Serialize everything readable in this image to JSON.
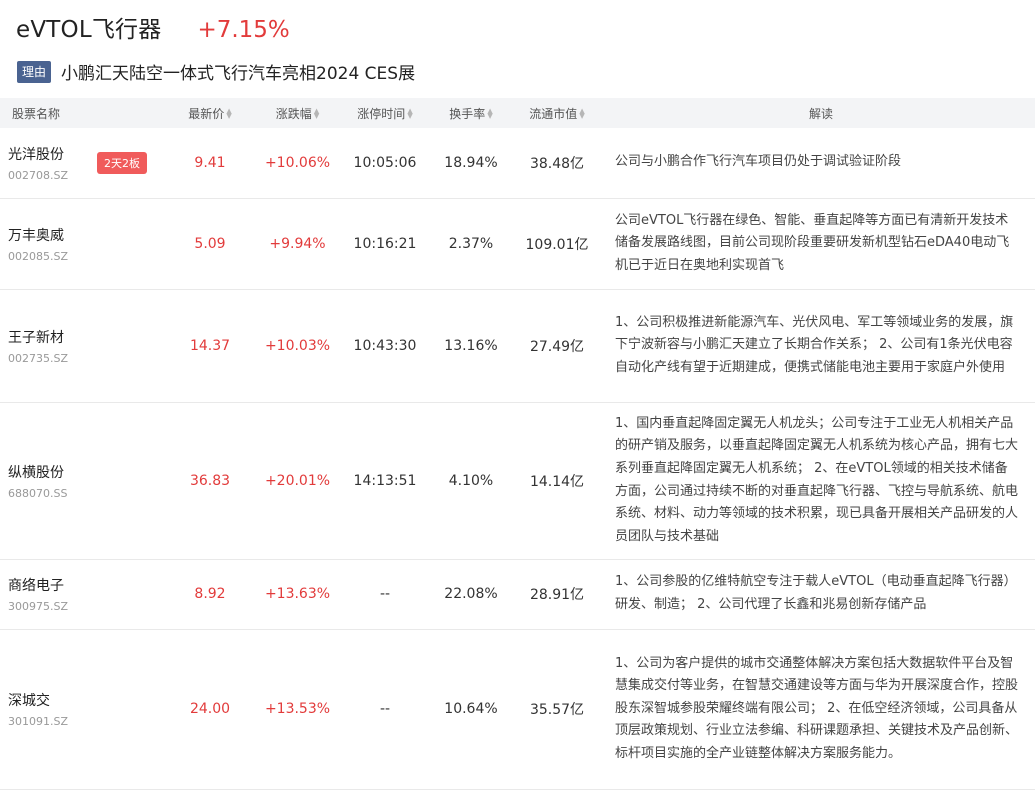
{
  "header": {
    "title": "eVTOL飞行器",
    "change": "+7.15%",
    "reason_tag": "理由",
    "reason_text": "小鹏汇天陆空一体式飞行汽车亮相2024 CES展"
  },
  "columns": {
    "name": "股票名称",
    "price": "最新价",
    "pct": "涨跌幅",
    "limit_time": "涨停时间",
    "turnover": "换手率",
    "mktcap": "流通市值",
    "desc": "解读"
  },
  "rows": [
    {
      "name": "光洋股份",
      "code": "002708.SZ",
      "badge": "2天2板",
      "price": "9.41",
      "pct": "+10.06%",
      "time": "10:05:06",
      "turnover": "18.94%",
      "mktcap": "38.48亿",
      "desc": "公司与小鹏合作飞行汽车项目仍处于调试验证阶段"
    },
    {
      "name": "万丰奥威",
      "code": "002085.SZ",
      "price": "5.09",
      "pct": "+9.94%",
      "time": "10:16:21",
      "turnover": "2.37%",
      "mktcap": "109.01亿",
      "desc": "公司eVTOL飞行器在绿色、智能、垂直起降等方面已有清新开发技术储备发展路线图，目前公司现阶段重要研发新机型钻石eDA40电动飞机已于近日在奥地利实现首飞"
    },
    {
      "name": "王子新材",
      "code": "002735.SZ",
      "price": "14.37",
      "pct": "+10.03%",
      "time": "10:43:30",
      "turnover": "13.16%",
      "mktcap": "27.49亿",
      "desc": "1、公司积极推进新能源汽车、光伏风电、军工等领域业务的发展，旗下宁波新容与小鹏汇天建立了长期合作关系； 2、公司有1条光伏电容自动化产线有望于近期建成，便携式储能电池主要用于家庭户外使用"
    },
    {
      "name": "纵横股份",
      "code": "688070.SS",
      "price": "36.83",
      "pct": "+20.01%",
      "time": "14:13:51",
      "turnover": "4.10%",
      "mktcap": "14.14亿",
      "desc": "1、国内垂直起降固定翼无人机龙头；公司专注于工业无人机相关产品的研产销及服务，以垂直起降固定翼无人机系统为核心产品，拥有七大系列垂直起降固定翼无人机系统； 2、在eVTOL领域的相关技术储备方面，公司通过持续不断的对垂直起降飞行器、飞控与导航系统、航电系统、材料、动力等领域的技术积累，现已具备开展相关产品研发的人员团队与技术基础"
    },
    {
      "name": "商络电子",
      "code": "300975.SZ",
      "price": "8.92",
      "pct": "+13.63%",
      "time": "--",
      "turnover": "22.08%",
      "mktcap": "28.91亿",
      "desc": "1、公司参股的亿维特航空专注于载人eVTOL（电动垂直起降飞行器）研发、制造； 2、公司代理了长鑫和兆易创新存储产品"
    },
    {
      "name": "深城交",
      "code": "301091.SZ",
      "price": "24.00",
      "pct": "+13.53%",
      "time": "--",
      "turnover": "10.64%",
      "mktcap": "35.57亿",
      "desc": "1、公司为客户提供的城市交通整体解决方案包括大数据软件平台及智慧集成交付等业务，在智慧交通建设等方面与华为开展深度合作，控股股东深智城参股荣耀终端有限公司； 2、在低空经济领域，公司具备从顶层政策规划、行业立法参编、科研课题承担、关键技术及产品创新、标杆项目实施的全产业链整体解决方案服务能力。"
    }
  ]
}
